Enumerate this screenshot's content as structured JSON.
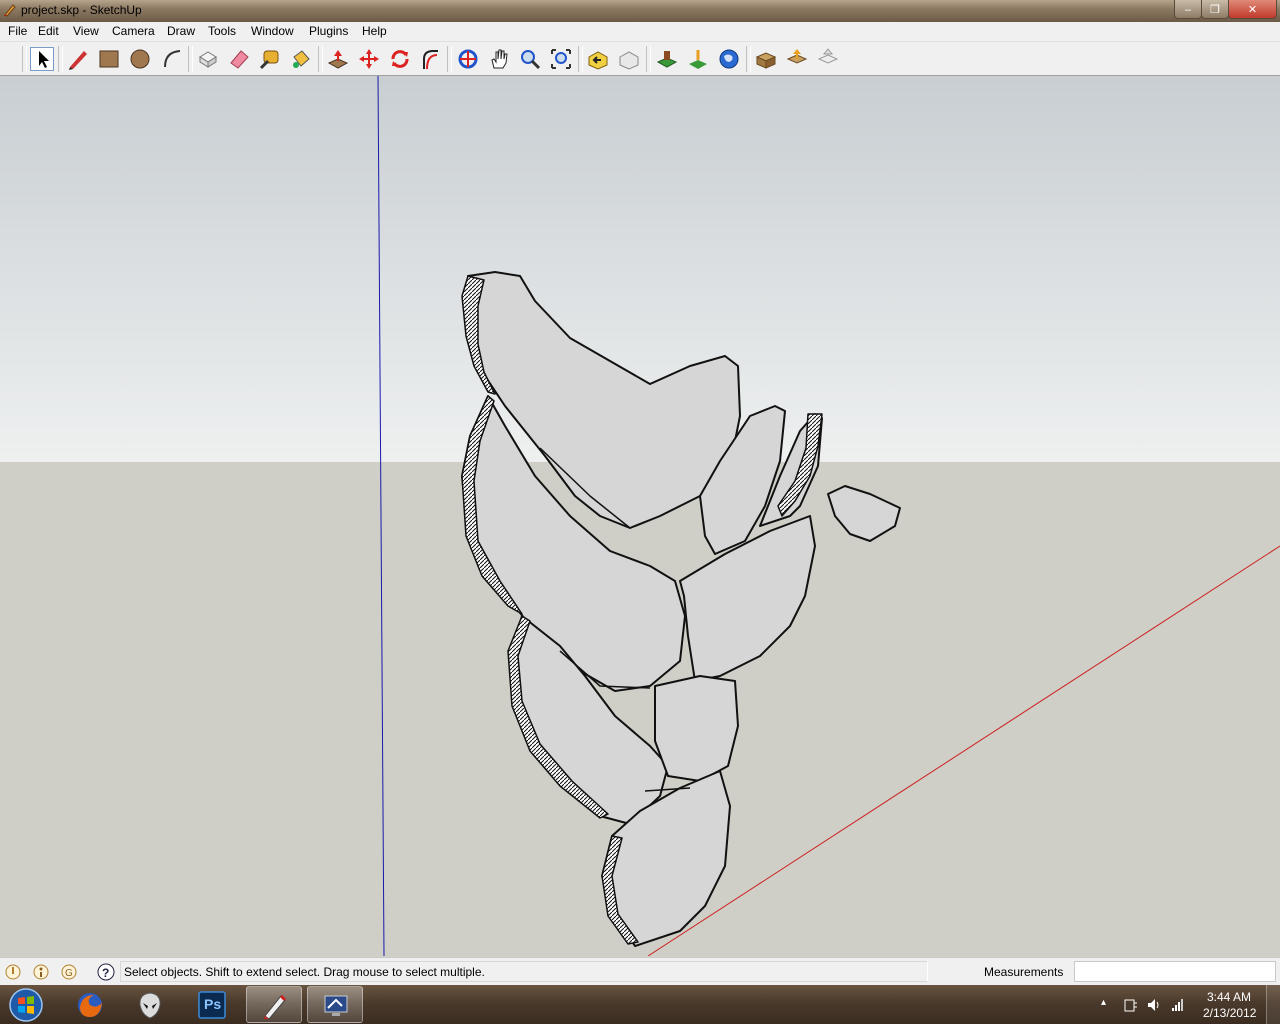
{
  "window": {
    "title": "project.skp - SketchUp",
    "minimize_glyph": "‒",
    "maximize_glyph": "❐",
    "close_glyph": "✕"
  },
  "menu": [
    "File",
    "Edit",
    "View",
    "Camera",
    "Draw",
    "Tools",
    "Window",
    "Plugins",
    "Help"
  ],
  "toolbar": {
    "tools": [
      {
        "name": "select-tool",
        "icon": "arrow-cursor-icon",
        "active": true
      },
      {
        "name": "line-tool",
        "icon": "pencil-icon"
      },
      {
        "name": "rectangle-tool",
        "icon": "rectangle-icon"
      },
      {
        "name": "circle-tool",
        "icon": "circle-icon"
      },
      {
        "name": "arc-tool",
        "icon": "arc-icon"
      },
      {
        "name": "make-component-tool",
        "icon": "component-icon"
      },
      {
        "name": "eraser-tool",
        "icon": "eraser-icon"
      },
      {
        "name": "tape-measure-tool",
        "icon": "tape-measure-icon"
      },
      {
        "name": "paint-bucket-tool",
        "icon": "paint-bucket-icon"
      },
      {
        "name": "push-pull-tool",
        "icon": "push-pull-icon"
      },
      {
        "name": "move-tool",
        "icon": "move-icon"
      },
      {
        "name": "rotate-tool",
        "icon": "rotate-icon"
      },
      {
        "name": "follow-me-tool",
        "icon": "follow-me-icon"
      },
      {
        "name": "orbit-tool",
        "icon": "orbit-icon"
      },
      {
        "name": "pan-tool",
        "icon": "hand-icon"
      },
      {
        "name": "zoom-tool",
        "icon": "magnifier-icon"
      },
      {
        "name": "zoom-extents-tool",
        "icon": "zoom-extents-icon"
      },
      {
        "name": "previous-view-tool",
        "icon": "previous-view-icon"
      },
      {
        "name": "next-view-tool",
        "icon": "next-view-icon"
      },
      {
        "name": "add-location-tool",
        "icon": "add-location-icon"
      },
      {
        "name": "toggle-terrain-tool",
        "icon": "terrain-icon"
      },
      {
        "name": "google-earth-tool",
        "icon": "globe-icon"
      },
      {
        "name": "get-models-tool",
        "icon": "get-models-icon"
      },
      {
        "name": "share-model-tool",
        "icon": "share-model-icon"
      },
      {
        "name": "share-component-tool",
        "icon": "share-component-icon"
      }
    ],
    "colors": {
      "red": "#cc2222",
      "green": "#3a9a3a",
      "blue": "#2255cc",
      "orange": "#e8a020",
      "brown": "#8b6a40"
    }
  },
  "viewport": {
    "sky_top": "#c8ced2",
    "sky_horizon": "#eef0f0",
    "ground": "#cfcfc7",
    "face_fill": "#d6d6d6",
    "edge_color": "#111111",
    "axis_blue": "#1a1aaa",
    "axis_red": "#cc2222"
  },
  "status": {
    "help_text": "Select objects. Shift to extend select. Drag mouse to select multiple.",
    "measurements_label": "Measurements",
    "measurements_value": ""
  },
  "taskbar": {
    "apps": [
      {
        "name": "firefox",
        "icon": "firefox-icon",
        "open": false
      },
      {
        "name": "alien",
        "icon": "alien-head-icon",
        "open": false
      },
      {
        "name": "photoshop",
        "icon": "photoshop-icon",
        "label": "Ps",
        "open": false
      },
      {
        "name": "sketchup",
        "icon": "sketchup-icon",
        "open": true
      },
      {
        "name": "remote-app",
        "icon": "display-icon",
        "open": true
      }
    ],
    "tray_arrow": "▴",
    "time": "3:44 AM",
    "date": "2/13/2012"
  }
}
